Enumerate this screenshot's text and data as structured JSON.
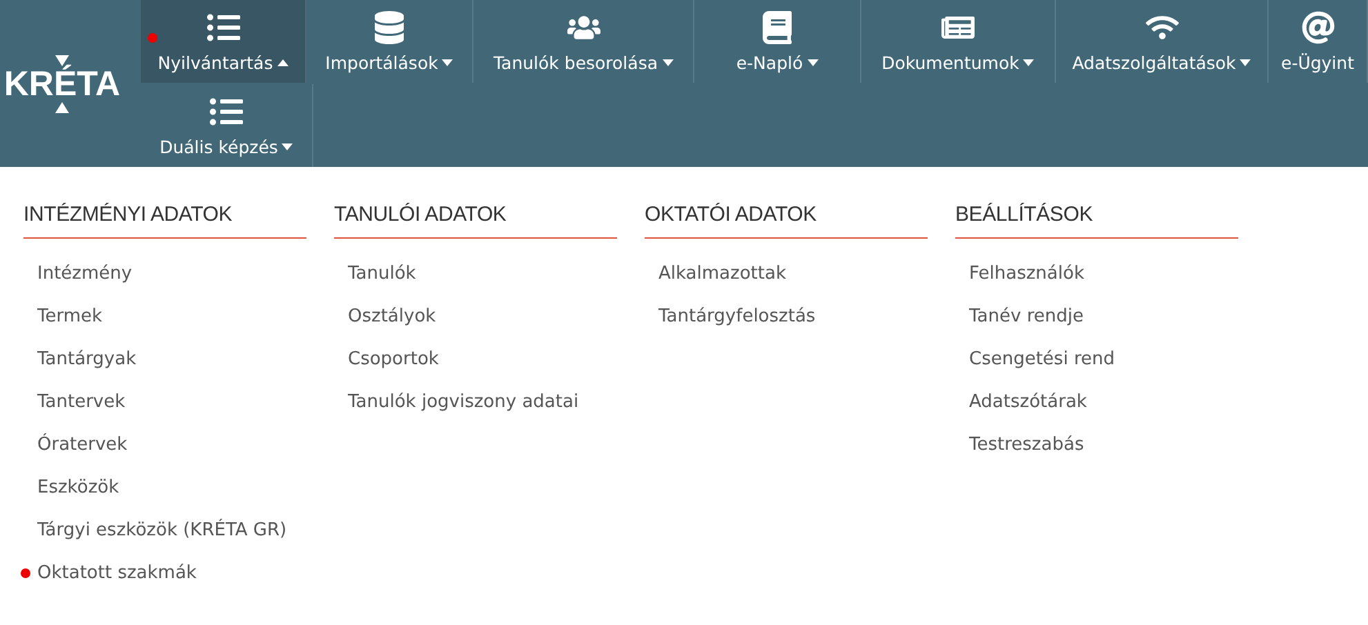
{
  "logo": {
    "text": "KRÉTA"
  },
  "nav": [
    {
      "label": "Nyilvántartás",
      "selected": true,
      "new": true,
      "caret": true
    },
    {
      "label": "Importálások",
      "selected": false,
      "new": false,
      "caret": true
    },
    {
      "label": "Tanulók besorolása",
      "selected": false,
      "new": false,
      "caret": true
    },
    {
      "label": "e-Napló",
      "selected": false,
      "new": false,
      "caret": true
    },
    {
      "label": "Dokumentumok",
      "selected": false,
      "new": false,
      "caret": true
    },
    {
      "label": "Adatszolgáltatások",
      "selected": false,
      "new": false,
      "caret": true
    },
    {
      "label": "e-Ügyint",
      "selected": false,
      "new": false,
      "caret": false
    },
    {
      "label": "Duális képzés",
      "selected": false,
      "new": false,
      "caret": true
    }
  ],
  "columns": [
    {
      "heading": "INTÉZMÉNYI ADATOK",
      "items": [
        {
          "label": "Intézmény",
          "new": false
        },
        {
          "label": "Termek",
          "new": false
        },
        {
          "label": "Tantárgyak",
          "new": false
        },
        {
          "label": "Tantervek",
          "new": false
        },
        {
          "label": "Óratervek",
          "new": false
        },
        {
          "label": "Eszközök",
          "new": false
        },
        {
          "label": "Tárgyi eszközök (KRÉTA GR)",
          "new": false
        },
        {
          "label": "Oktatott szakmák",
          "new": true
        }
      ]
    },
    {
      "heading": "TANULÓI ADATOK",
      "items": [
        {
          "label": "Tanulók",
          "new": false
        },
        {
          "label": "Osztályok",
          "new": false
        },
        {
          "label": "Csoportok",
          "new": false
        },
        {
          "label": "Tanulók jogviszony adatai",
          "new": false
        }
      ]
    },
    {
      "heading": "OKTATÓI ADATOK",
      "items": [
        {
          "label": "Alkalmazottak",
          "new": false
        },
        {
          "label": "Tantárgyfelosztás",
          "new": false
        }
      ]
    },
    {
      "heading": "BEÁLLÍTÁSOK",
      "items": [
        {
          "label": "Felhasználók",
          "new": false
        },
        {
          "label": "Tanév rendje",
          "new": false
        },
        {
          "label": "Csengetési rend",
          "new": false
        },
        {
          "label": "Adatszótárak",
          "new": false
        },
        {
          "label": "Testreszabás",
          "new": false
        }
      ]
    }
  ]
}
